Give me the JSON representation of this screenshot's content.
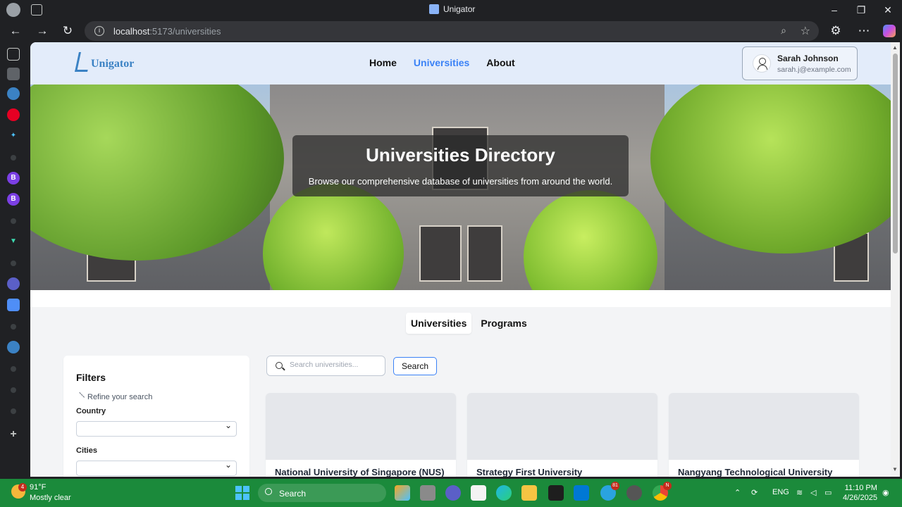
{
  "browser": {
    "tab_title": "Unigator",
    "url_host": "localhost",
    "url_path": ":5173/universities"
  },
  "app": {
    "logo_text": "Unigator",
    "nav": [
      {
        "label": "Home",
        "active": false
      },
      {
        "label": "Universities",
        "active": true
      },
      {
        "label": "About",
        "active": false
      }
    ],
    "user": {
      "name": "Sarah Johnson",
      "email": "sarah.j@example.com"
    }
  },
  "hero": {
    "title": "Universities Directory",
    "subtitle": "Browse our comprehensive database of universities from around the world."
  },
  "tabs": [
    {
      "label": "Universities",
      "active": true
    },
    {
      "label": "Programs",
      "active": false
    }
  ],
  "filters": {
    "title": "Filters",
    "refine": "Refine your search",
    "country_label": "Country",
    "cities_label": "Cities",
    "country_value": "",
    "cities_value": ""
  },
  "search": {
    "placeholder": "Search universities...",
    "button": "Search"
  },
  "cards": [
    {
      "name": "National University of Singapore (NUS)"
    },
    {
      "name": "Strategy First University"
    },
    {
      "name": "Nangyang Technological University"
    }
  ],
  "taskbar": {
    "temperature": "91°F",
    "condition": "Mostly clear",
    "weather_badge": "4",
    "search_label": "Search",
    "language": "ENG",
    "time": "11:10 PM",
    "date": "4/26/2025",
    "telegram_badge": "81",
    "chrome_badge": "N"
  },
  "colors": {
    "accent": "#3b82f6",
    "header_bg": "#e3ecfa",
    "taskbar_bg": "#1b8a3b"
  }
}
